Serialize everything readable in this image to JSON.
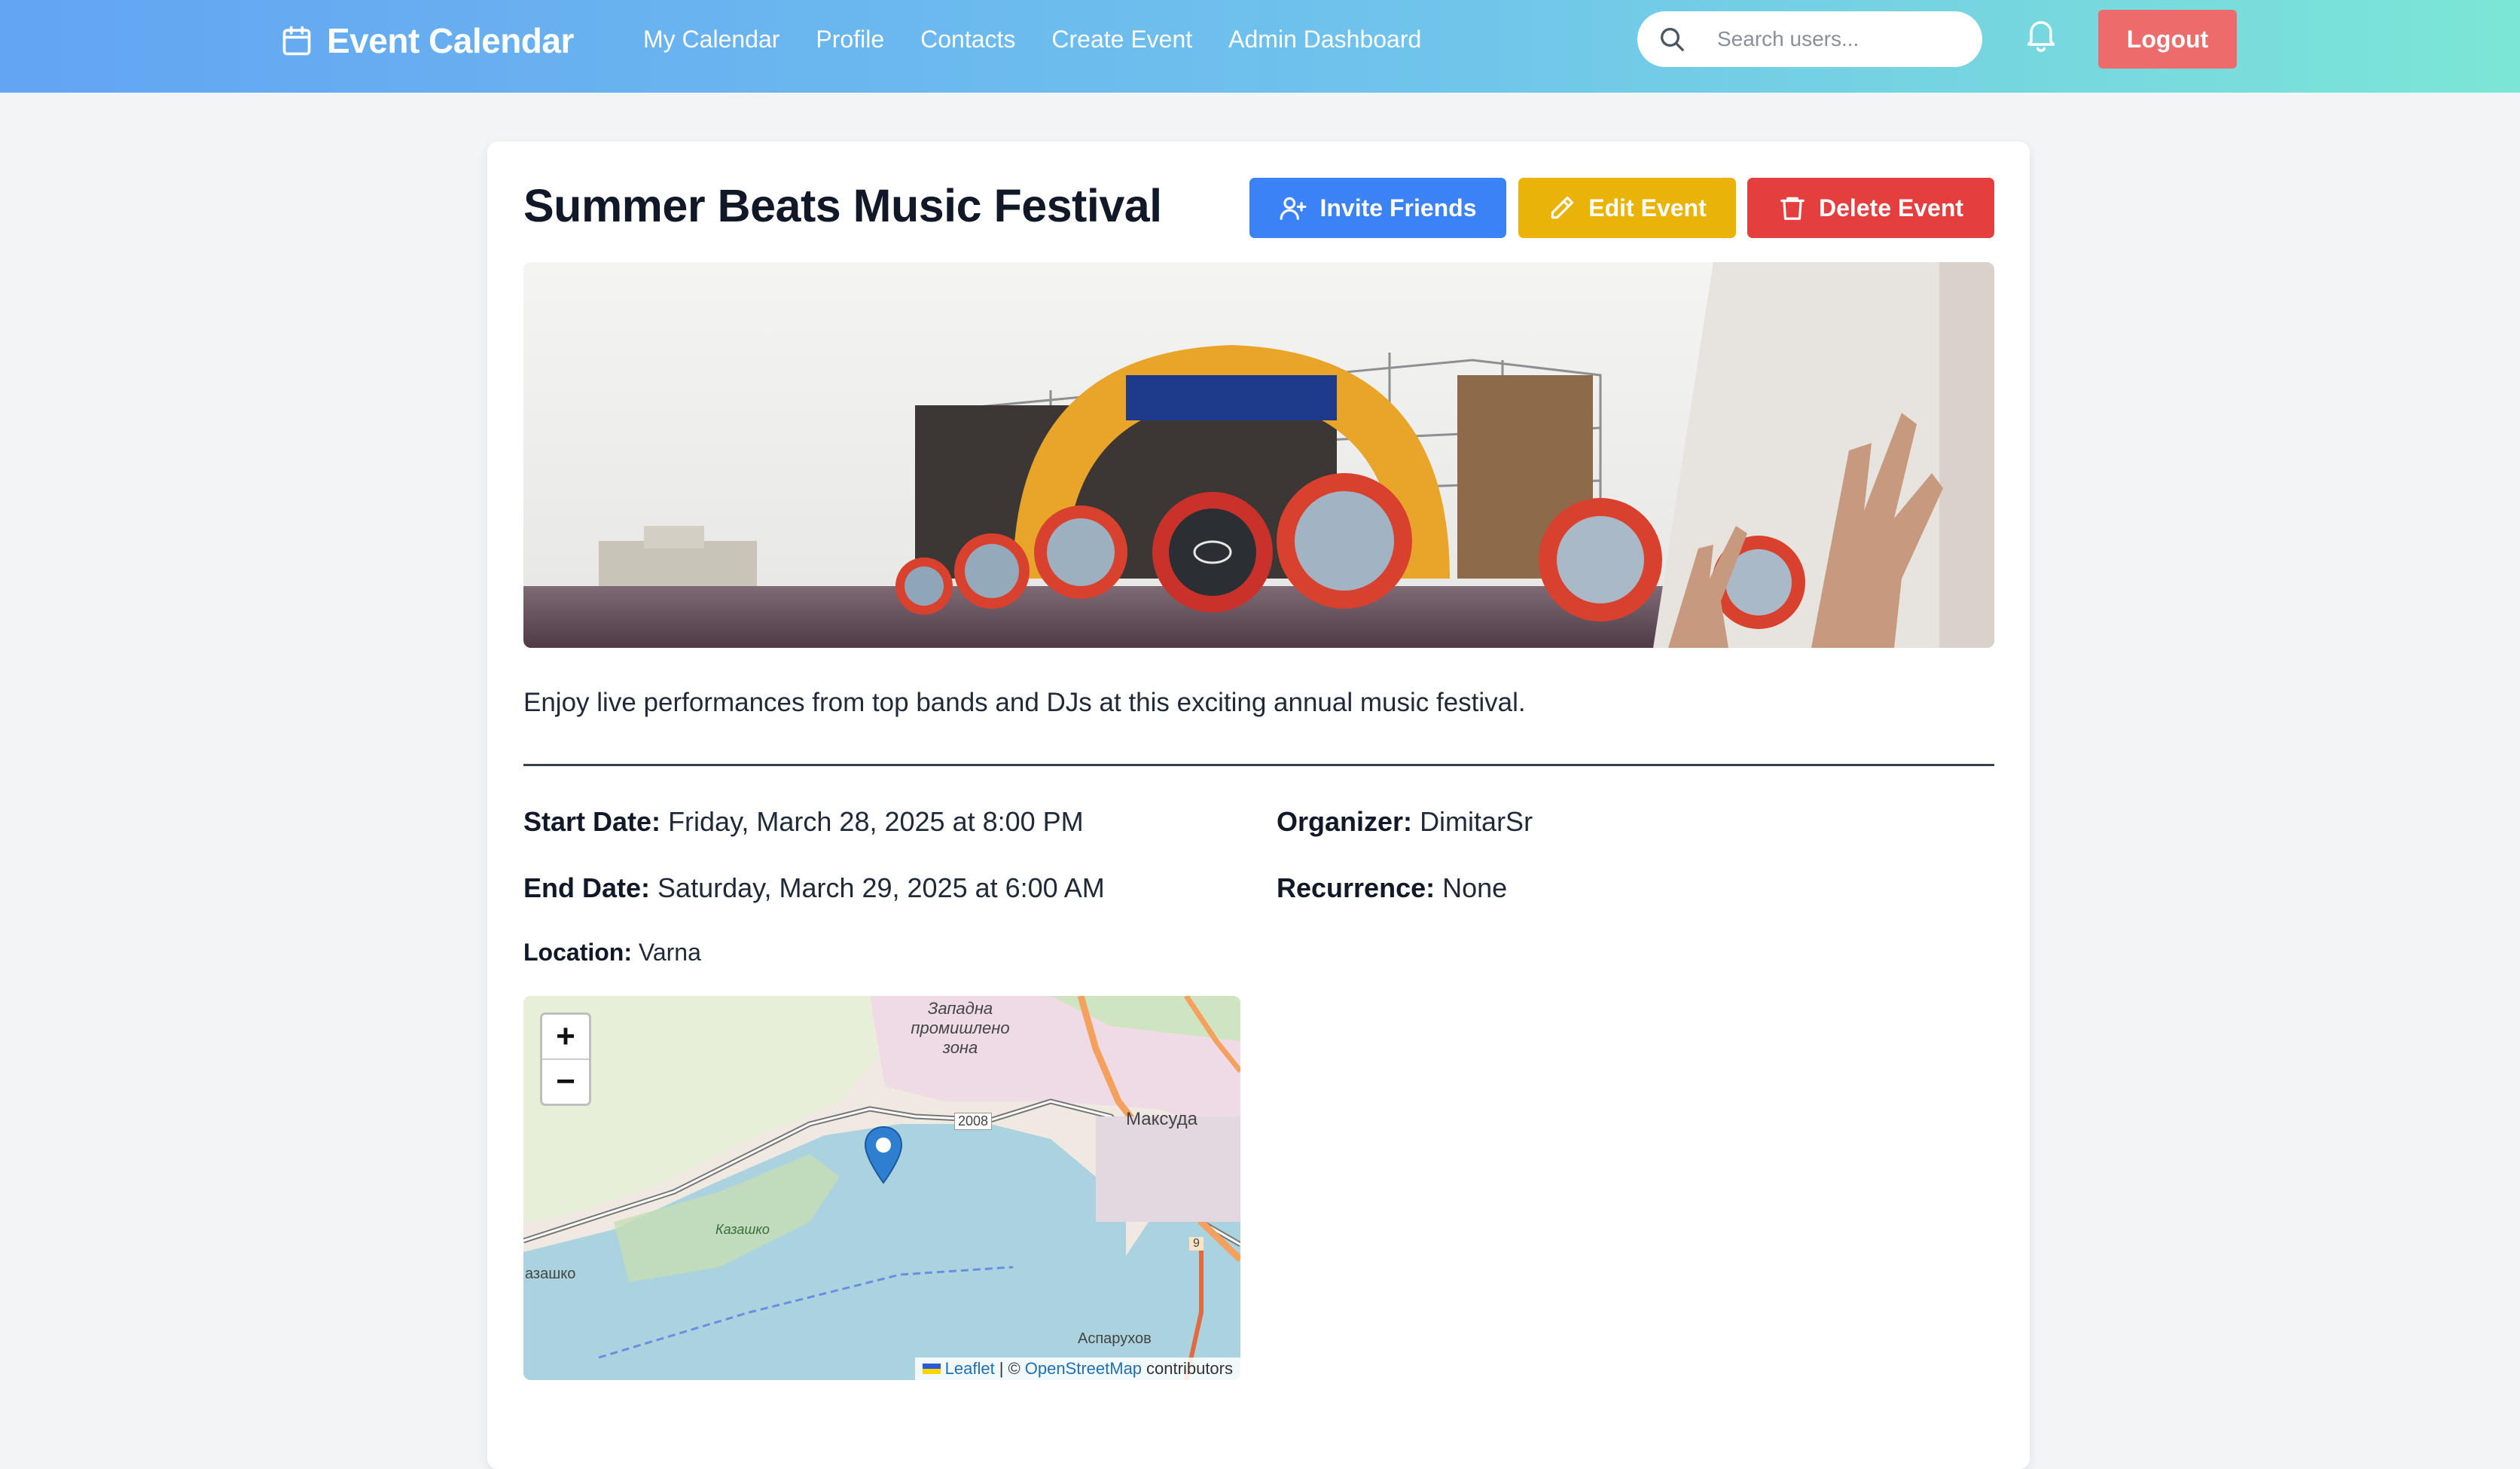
{
  "navbar": {
    "brand": "Event Calendar",
    "links": [
      "My Calendar",
      "Profile",
      "Contacts",
      "Create Event",
      "Admin Dashboard"
    ],
    "search_placeholder": "Search users...",
    "logout_label": "Logout"
  },
  "event": {
    "title": "Summer Beats Music Festival",
    "actions": {
      "invite": "Invite Friends",
      "edit": "Edit Event",
      "delete": "Delete Event"
    },
    "description": "Enjoy live performances from top bands and DJs at this exciting annual music festival.",
    "details": {
      "start_label": "Start Date:",
      "start_value": "Friday, March 28, 2025 at 8:00 PM",
      "end_label": "End Date:",
      "end_value": "Saturday, March 29, 2025 at 6:00 AM",
      "location_label": "Location:",
      "location_value": "Varna",
      "organizer_label": "Organizer:",
      "organizer_value": "DimitarSr",
      "recurrence_label": "Recurrence:",
      "recurrence_value": "None"
    }
  },
  "map": {
    "zoom_in": "+",
    "zoom_out": "−",
    "labels": {
      "zone": "Западна промишлено зона",
      "district": "Максуда",
      "road": "2008",
      "kazashko": "Казашко",
      "left_edge": "азашко",
      "asparuhov": "Аспарухов",
      "route": "9"
    },
    "attribution": {
      "leaflet": "Leaflet",
      "sep": "| ©",
      "osm": "OpenStreetMap",
      "contributors": "contributors"
    }
  },
  "colors": {
    "invite": "#3b82f6",
    "edit": "#eab308",
    "delete": "#e53e3e",
    "logout": "#ee6b6b"
  }
}
